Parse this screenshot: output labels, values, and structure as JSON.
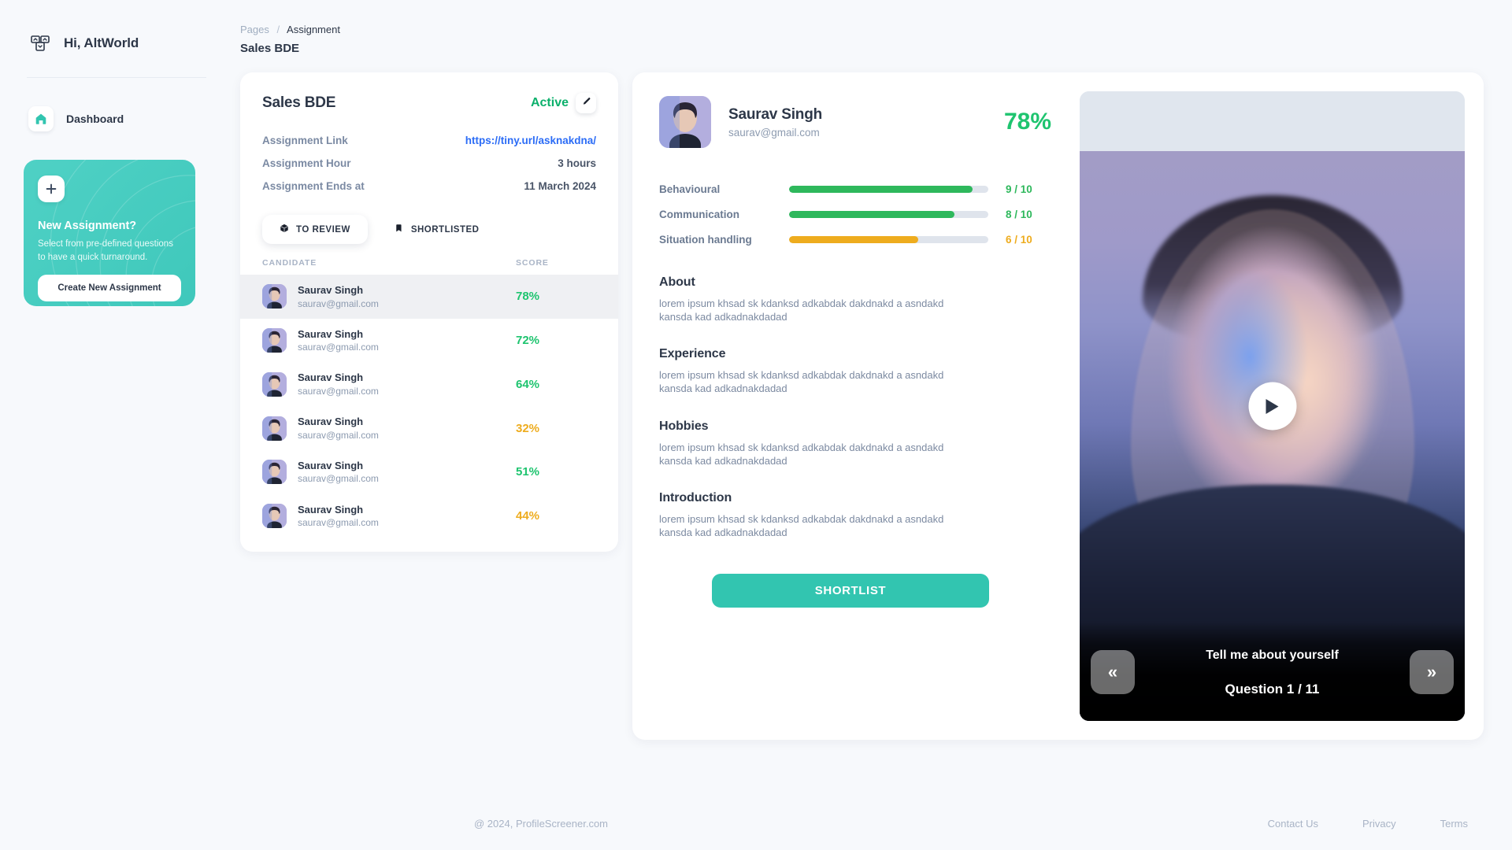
{
  "sidebar": {
    "brand": "Hi, AltWorld",
    "brand_icon": "app-grid-icon",
    "nav": [
      {
        "label": "Dashboard",
        "icon": "home-icon"
      }
    ],
    "promo": {
      "plus_icon": "plus-icon",
      "title": "New Assignment?",
      "subtitle": "Select from pre-defined questions to have a quick turnaround.",
      "button": "Create New Assignment"
    }
  },
  "header": {
    "breadcrumb_parent": "Pages",
    "breadcrumb_sep": "/",
    "breadcrumb_current": "Assignment",
    "page_title": "Sales BDE"
  },
  "assignment": {
    "name": "Sales BDE",
    "status": "Active",
    "edit_icon": "pencil-icon",
    "details": [
      {
        "label": "Assignment Link",
        "value": "https://tiny.url/asknakdna/",
        "is_link": true
      },
      {
        "label": "Assignment Hour",
        "value": "3 hours",
        "is_link": false
      },
      {
        "label": "Assignment Ends at",
        "value": "11 March 2024",
        "is_link": false
      }
    ],
    "tabs": [
      {
        "label": "TO REVIEW",
        "icon": "cube-icon",
        "active": true
      },
      {
        "label": "SHORTLISTED",
        "icon": "bookmark-icon",
        "active": false
      }
    ],
    "list_headers": {
      "candidate": "CANDIDATE",
      "score": "SCORE"
    },
    "candidates": [
      {
        "name": "Saurav Singh",
        "email": "saurav@gmail.com",
        "score": "78%",
        "color": "#1ec46f",
        "selected": true
      },
      {
        "name": "Saurav Singh",
        "email": "saurav@gmail.com",
        "score": "72%",
        "color": "#1ec46f",
        "selected": false
      },
      {
        "name": "Saurav Singh",
        "email": "saurav@gmail.com",
        "score": "64%",
        "color": "#1ec46f",
        "selected": false
      },
      {
        "name": "Saurav Singh",
        "email": "saurav@gmail.com",
        "score": "32%",
        "color": "#eeac1e",
        "selected": false
      },
      {
        "name": "Saurav Singh",
        "email": "saurav@gmail.com",
        "score": "51%",
        "color": "#1ec46f",
        "selected": false
      },
      {
        "name": "Saurav Singh",
        "email": "saurav@gmail.com",
        "score": "44%",
        "color": "#eeac1e",
        "selected": false
      }
    ]
  },
  "candidate_detail": {
    "name": "Saurav Singh",
    "email": "saurav@gmail.com",
    "score": "78%",
    "skills": [
      {
        "label": "Behavioural",
        "value": "9 / 10",
        "percent": 92,
        "color": "#2eb85c"
      },
      {
        "label": "Communication",
        "value": "8 / 10",
        "percent": 83,
        "color": "#2eb85c"
      },
      {
        "label": "Situation handling",
        "value": "6 / 10",
        "percent": 65,
        "color": "#eeac1e"
      }
    ],
    "sections": [
      {
        "title": "About",
        "body": "lorem ipsum khsad sk kdanksd adkabdak dakdnakd a asndakd kansda kad adkadnakdadad"
      },
      {
        "title": "Experience",
        "body": "lorem ipsum khsad sk kdanksd adkabdak dakdnakd a asndakd kansda kad adkadnakdadad"
      },
      {
        "title": "Hobbies",
        "body": "lorem ipsum khsad sk kdanksd adkabdak dakdnakd a asndakd kansda kad adkadnakdadad"
      },
      {
        "title": "Introduction",
        "body": "lorem ipsum khsad sk kdanksd adkabdak dakdnakd a asndakd kansda kad adkadnakdadad"
      }
    ],
    "shortlist_button": "SHORTLIST"
  },
  "video": {
    "play_icon": "play-icon",
    "question_text": "Tell me about yourself",
    "counter": "Question 1 / 11",
    "prev_icon": "chevron-double-left-icon",
    "next_icon": "chevron-double-right-icon",
    "prev_label": "«",
    "next_label": "»"
  },
  "footer": {
    "copyright": "@ 2024, ProfileScreener.com",
    "links": [
      "Contact Us",
      "Privacy",
      "Terms"
    ]
  },
  "colors": {
    "accent_teal": "#32c5b0",
    "green": "#1ec46f",
    "amber": "#eeac1e",
    "link_blue": "#2b6cf6"
  }
}
